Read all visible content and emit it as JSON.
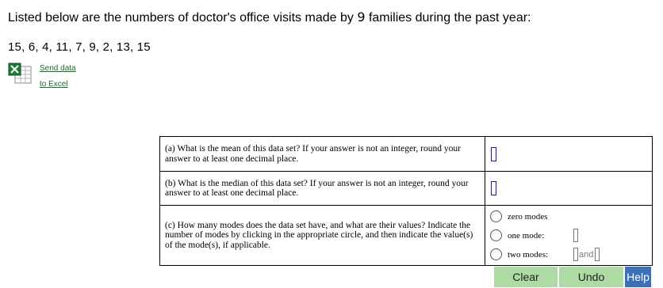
{
  "intro": {
    "before": "Listed below are the numbers of doctor's office visits made by ",
    "count": "9",
    "after": " families during the past year:"
  },
  "data_values": "15, 6, 4, 11, 7, 9, 2, 13, 15",
  "excel": {
    "icon": "excel-icon",
    "link_line1": "Send data",
    "link_line2": "to Excel"
  },
  "questions": {
    "a": "(a) What is the mean of this data set? If your answer is not an integer, round your answer to at least one decimal place.",
    "b": "(b) What is the median of this data set? If your answer is not an integer, round your answer to at least one decimal place.",
    "c": "(c) How many modes does the data set have, and what are their values? Indicate the number of modes by clicking in the appropriate circle, and then indicate the value(s) of the mode(s), if applicable."
  },
  "answers": {
    "mean": "",
    "median": ""
  },
  "modes": {
    "zero": "zero modes",
    "one": "one mode:",
    "two": "two modes:",
    "and": "and"
  },
  "buttons": {
    "clear": "Clear",
    "undo": "Undo",
    "help": "Help"
  },
  "colors": {
    "button_green": "#aedba4",
    "help_blue": "#3b6fb8",
    "link_green": "#1a6c2a"
  }
}
